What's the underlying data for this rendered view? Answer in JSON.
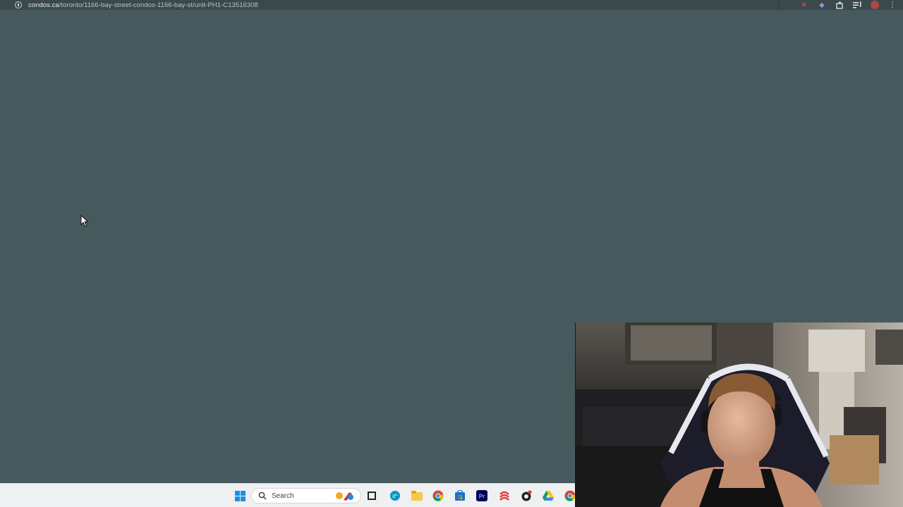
{
  "browser": {
    "url_host": "condos.ca",
    "url_path": "/toronto/1166-bay-street-condos-1166-bay-st/unit-PH1-C13516308",
    "icons": [
      "site-info-icon",
      "extension-icon",
      "extension-icon",
      "extensions-puzzle-icon",
      "reading-list-icon",
      "profile-avatar",
      "more-menu-icon"
    ]
  },
  "taskbar": {
    "search_placeholder": "Search",
    "apps": [
      "start-button",
      "task-view",
      "edge",
      "file-explorer",
      "chrome",
      "microsoft-store",
      "premiere-pro",
      "app-red",
      "app-black",
      "google-drive",
      "chrome"
    ]
  },
  "colors": {
    "page_background": "#465a5d",
    "address_bar": "#39494c",
    "taskbar": "#eef0f2",
    "accent": "#1a8fe3"
  }
}
